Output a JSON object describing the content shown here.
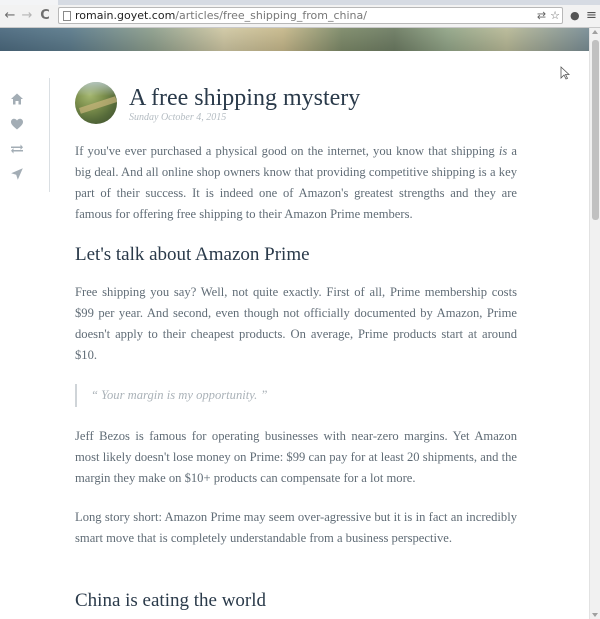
{
  "browser": {
    "url_host": "romain.goyet.com",
    "url_path": "/articles/free_shipping_from_china/",
    "back_icon": "back-arrow-icon",
    "forward_icon": "forward-arrow-icon",
    "reload_icon": "reload-icon",
    "back_glyph": "←",
    "forward_glyph": "→",
    "reload_glyph": "C",
    "translate_glyph": "⇄",
    "star_glyph": "☆",
    "bulb_glyph": "●",
    "menu_glyph": "≡"
  },
  "sidebar": {
    "items": [
      {
        "icon": "home-icon"
      },
      {
        "icon": "heart-icon"
      },
      {
        "icon": "retweet-icon"
      },
      {
        "icon": "send-icon"
      }
    ]
  },
  "article": {
    "title": "A free shipping mystery",
    "date": "Sunday October 4, 2015",
    "intro_before": "If you've ever purchased a physical good on the internet, you know that shipping ",
    "intro_em": "is",
    "intro_after": " a big deal. And all online shop owners know that providing competitive shipping is a key part of their success. It is indeed one of Amazon's greatest strengths and they are famous for offering free shipping to their Amazon Prime members.",
    "heading1": "Let's talk about Amazon Prime",
    "para2": "Free shipping you say? Well, not quite exactly. First of all, Prime membership costs $99 per year. And second, even though not officially documented by Amazon, Prime doesn't apply to their cheapest products. On average, Prime products start at around $10.",
    "quote": "“ Your margin is my opportunity. ”",
    "para3": "Jeff Bezos is famous for operating businesses with near-zero margins. Yet Amazon most likely doesn't lose money on Prime: $99 can pay for at least 20 shipments, and the margin they make on $10+ products can compensate for a lot more.",
    "para4": "Long story short: Amazon Prime may seem over-agressive but it is in fact an incredibly smart move that is completely understandable from a business perspective.",
    "heading2": "China is eating the world"
  },
  "colors": {
    "title": "#2a3a4a",
    "body_text": "#606c76",
    "muted": "#b4bcc2",
    "nav_icon": "#a3adb5"
  }
}
